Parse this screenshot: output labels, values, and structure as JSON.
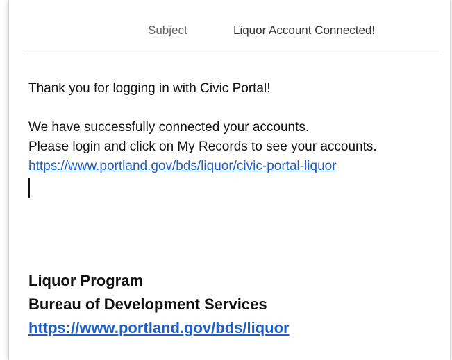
{
  "header": {
    "subject_label": "Subject",
    "subject_value": "Liquor Account Connected!"
  },
  "message": {
    "greeting": "Thank you for logging in with Civic Portal!",
    "line1": "We have successfully connected your accounts.",
    "line2": "Please login and click on My Records to see your accounts.",
    "link": "https://www.portland.gov/bds/liquor/civic-portal-liquor"
  },
  "signature": {
    "program": "Liquor Program",
    "bureau": "Bureau of Development Services",
    "link": "https://www.portland.gov/bds/liquor"
  },
  "colors": {
    "link": "#1f5fc2",
    "label": "#666666"
  }
}
